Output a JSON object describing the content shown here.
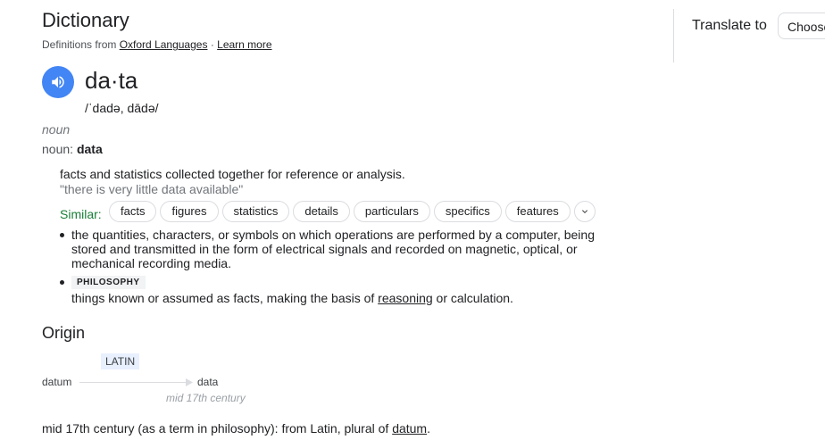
{
  "header": {
    "title": "Dictionary",
    "source_prefix": "Definitions from",
    "source_link": "Oxford Languages",
    "separator": "·",
    "learn_more": "Learn more"
  },
  "translate": {
    "label": "Translate to",
    "select_value": "Choose language"
  },
  "entry": {
    "word": "da·ta",
    "pronunciation": "/ˈdadə, dādə/",
    "part_of_speech": "noun",
    "pos_prefix": "noun:",
    "pos_word": "data"
  },
  "definitions": [
    {
      "text": "facts and statistics collected together for reference or analysis.",
      "example": "\"there is very little data available\""
    },
    {
      "text_lines": [
        "the quantities, characters, or symbols on which operations are performed by a computer, being",
        "stored and transmitted in the form of electrical signals and recorded on magnetic, optical, or",
        "mechanical recording media."
      ]
    },
    {
      "tag": "PHILOSOPHY",
      "text_before": "things known or assumed as facts, making the basis of ",
      "link": "reasoning",
      "text_after": " or calculation."
    }
  ],
  "similar": {
    "label": "Similar:",
    "chips": [
      "facts",
      "figures",
      "statistics",
      "details",
      "particulars",
      "specifics",
      "features"
    ]
  },
  "origin": {
    "title": "Origin",
    "badge": "LATIN",
    "from_word": "datum",
    "to_word": "data",
    "date": "mid 17th century",
    "text_before": "mid 17th century (as a term in philosophy): from Latin, plural of ",
    "link": "datum",
    "text_after": "."
  },
  "colors": {
    "accent": "#4285f4",
    "similar_label": "#188038",
    "badge_bg": "#e8f0fe"
  },
  "icons": {
    "speaker": "speaker-icon",
    "expand": "chevron-down-icon"
  }
}
